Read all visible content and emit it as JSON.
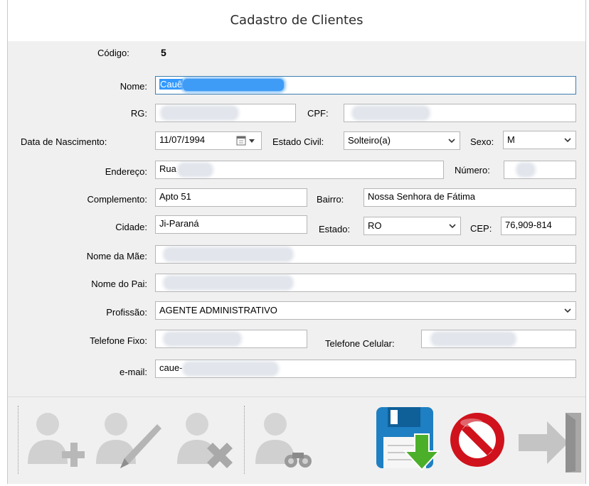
{
  "window": {
    "title": "Cadastro de Clientes"
  },
  "form": {
    "codigo": {
      "label": "Código:",
      "value": "5"
    },
    "nome": {
      "label": "Nome:",
      "value": "Cauê"
    },
    "rg": {
      "label": "RG:"
    },
    "cpf": {
      "label": "CPF:"
    },
    "nascimento": {
      "label": "Data de Nascimento:",
      "value": "11/07/1994"
    },
    "estado_civil": {
      "label": "Estado Civil:",
      "value": "Solteiro(a)"
    },
    "sexo": {
      "label": "Sexo:",
      "value": "M"
    },
    "endereco": {
      "label": "Endereço:",
      "value": "Rua"
    },
    "numero": {
      "label": "Número:"
    },
    "complemento": {
      "label": "Complemento:",
      "value": "Apto 51"
    },
    "bairro": {
      "label": "Bairro:",
      "value": "Nossa Senhora de Fátima"
    },
    "cidade": {
      "label": "Cidade:",
      "value": "Ji-Paraná"
    },
    "estado": {
      "label": "Estado:",
      "value": "RO"
    },
    "cep": {
      "label": "CEP:",
      "value": "76,909-814"
    },
    "nome_mae": {
      "label": "Nome da Mãe:"
    },
    "nome_pai": {
      "label": "Nome do Pai:"
    },
    "profissao": {
      "label": "Profissão:",
      "value": "AGENTE ADMINISTRATIVO"
    },
    "telefone_fixo": {
      "label": "Telefone Fixo:"
    },
    "telefone_celular": {
      "label": "Telefone Celular:"
    },
    "email": {
      "label": "e-mail:",
      "value": "caue-"
    }
  },
  "toolbar": {
    "buttons": [
      {
        "name": "add-client-button",
        "icon": "user-add-icon",
        "enabled": false
      },
      {
        "name": "edit-client-button",
        "icon": "user-edit-icon",
        "enabled": false
      },
      {
        "name": "delete-client-button",
        "icon": "user-delete-icon",
        "enabled": false
      },
      {
        "name": "search-client-button",
        "icon": "user-search-icon",
        "enabled": false
      },
      {
        "name": "save-button",
        "icon": "save-icon",
        "enabled": true
      },
      {
        "name": "cancel-button",
        "icon": "cancel-icon",
        "enabled": true
      },
      {
        "name": "exit-button",
        "icon": "exit-icon",
        "enabled": false
      }
    ]
  },
  "colors": {
    "accent": "#3399ff",
    "focus_border": "#3c7fb1",
    "save_green": "#4caf2a",
    "cancel_red": "#d0121c"
  }
}
